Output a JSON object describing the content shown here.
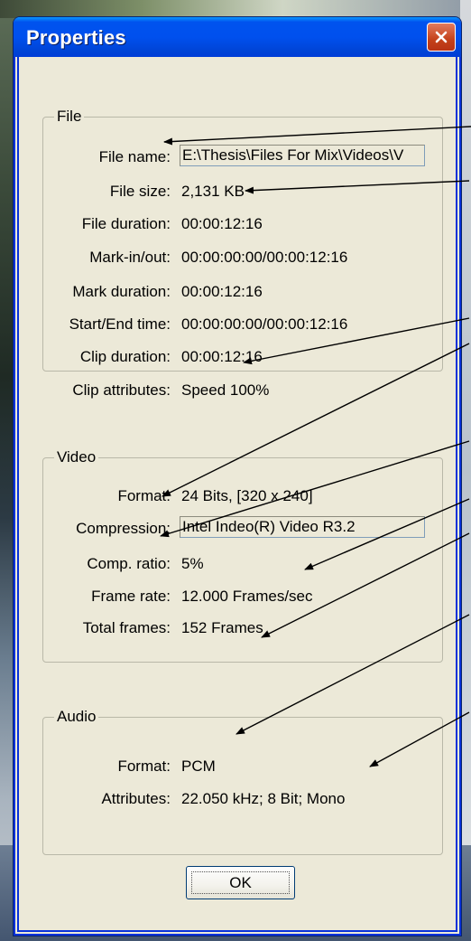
{
  "window": {
    "title": "Properties"
  },
  "file_group": {
    "legend": "File",
    "rows": [
      {
        "label": "File name:",
        "value": "E:\\Thesis\\Files For Mix\\Videos\\V"
      },
      {
        "label": "File size:",
        "value": "2,131 KB"
      },
      {
        "label": "File duration:",
        "value": "00:00:12:16"
      },
      {
        "label": "Mark-in/out:",
        "value": "00:00:00:00/00:00:12:16"
      },
      {
        "label": "Mark duration:",
        "value": "00:00:12:16"
      },
      {
        "label": "Start/End time:",
        "value": "00:00:00:00/00:00:12:16"
      },
      {
        "label": "Clip duration:",
        "value": "00:00:12:16"
      },
      {
        "label": "Clip attributes:",
        "value": "Speed 100%"
      }
    ]
  },
  "video_group": {
    "legend": "Video",
    "rows": [
      {
        "label": "Format:",
        "value": "24 Bits, [320 x 240]"
      },
      {
        "label": "Compression:",
        "value": "Intel Indeo(R) Video R3.2"
      },
      {
        "label": "Comp. ratio:",
        "value": "5%"
      },
      {
        "label": "Frame rate:",
        "value": "12.000 Frames/sec"
      },
      {
        "label": "Total frames:",
        "value": "152 Frames"
      }
    ]
  },
  "audio_group": {
    "legend": "Audio",
    "rows": [
      {
        "label": "Format:",
        "value": "PCM"
      },
      {
        "label": "Attributes:",
        "value": "22.050 kHz; 8 Bit; Mono"
      }
    ]
  },
  "buttons": {
    "ok": "OK"
  },
  "icons": {
    "close": "close-icon"
  },
  "colors": {
    "titlebar": "#0053ee",
    "close": "#c4411a",
    "dialog_bg": "#ece9d8"
  }
}
